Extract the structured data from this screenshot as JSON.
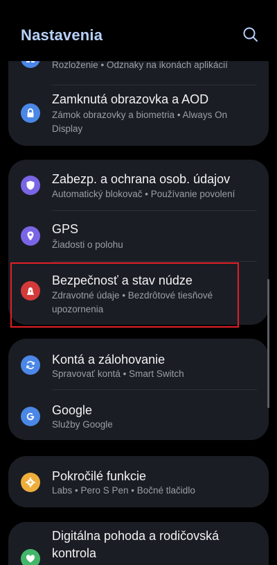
{
  "header": {
    "title": "Nastavenia",
    "search_icon": "search-icon"
  },
  "colors": {
    "title": "#b7d1fb",
    "card_bg": "#1b1d24",
    "highlight_border": "#e21f26",
    "icon_blue": "#4b87e6",
    "icon_purple": "#7a65e6",
    "icon_red": "#d33a3a",
    "icon_orange": "#efae3b",
    "icon_green": "#43b66a"
  },
  "items": {
    "home_screen": {
      "subtitle": "Rozloženie • Odznaky na ikonách aplikácií",
      "icon": "grid-icon"
    },
    "lock_screen": {
      "title": "Zamknutá obrazovka a AOD",
      "subtitle": "Zámok obrazovky a biometria • Always On Display",
      "icon": "lock-icon"
    },
    "security": {
      "title": "Zabezp. a ochrana osob. údajov",
      "subtitle": "Automatický blokovač • Používanie povolení",
      "icon": "shield-icon"
    },
    "gps": {
      "title": "GPS",
      "subtitle": "Žiadosti o polohu",
      "icon": "location-pin-icon"
    },
    "safety": {
      "title": "Bezpečnosť a stav núdze",
      "subtitle": "Zdravotné údaje • Bezdrôtové tiesňové upozornenia",
      "icon": "emergency-icon"
    },
    "accounts": {
      "title": "Kontá a zálohovanie",
      "subtitle": "Spravovať kontá • Smart Switch",
      "icon": "sync-icon"
    },
    "google": {
      "title": "Google",
      "subtitle": "Služby Google",
      "icon": "google-icon"
    },
    "advanced": {
      "title": "Pokročilé funkcie",
      "subtitle": "Labs • Pero S Pen • Bočné tlačidlo",
      "icon": "gear-plus-icon"
    },
    "wellbeing": {
      "title": "Digitálna pohoda a rodičovská kontrola",
      "icon": "heart-icon"
    }
  }
}
